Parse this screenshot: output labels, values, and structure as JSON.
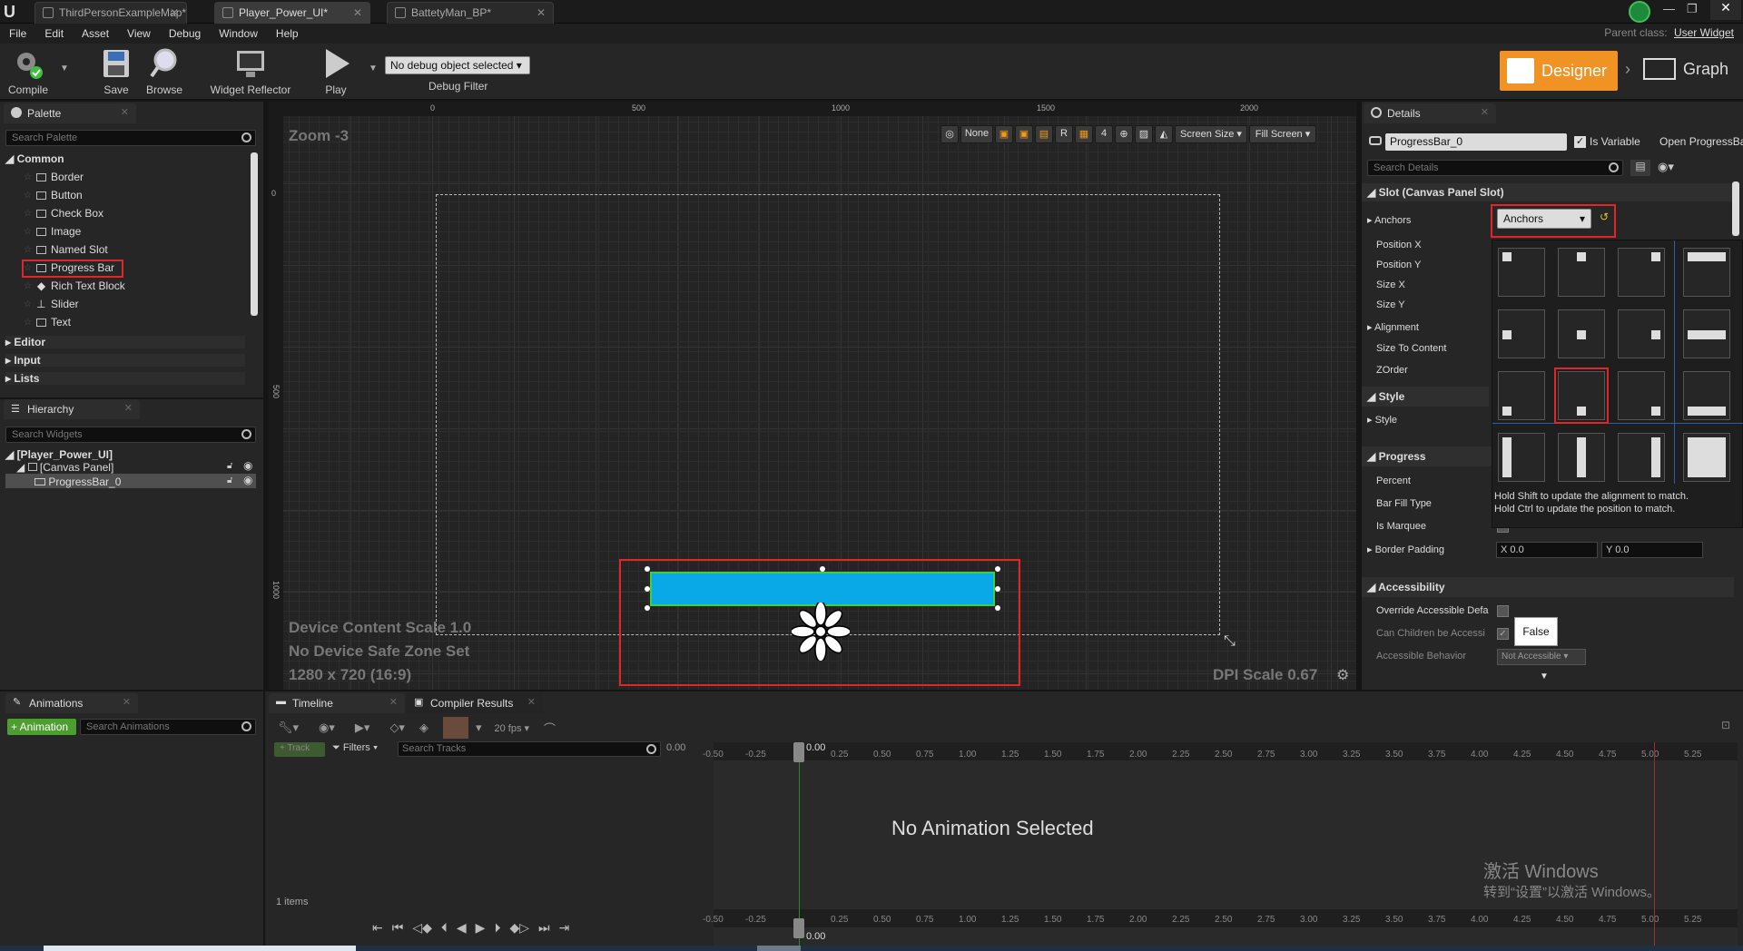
{
  "tabs": [
    {
      "label": "ThirdPersonExampleMap*",
      "active": false
    },
    {
      "label": "Player_Power_UI*",
      "active": true
    },
    {
      "label": "BattetyMan_BP*",
      "active": false
    }
  ],
  "parent_class": {
    "label": "Parent class:",
    "value": "User Widget"
  },
  "menu": [
    "File",
    "Edit",
    "Asset",
    "View",
    "Debug",
    "Window",
    "Help"
  ],
  "toolbar": {
    "compile": "Compile",
    "save": "Save",
    "browse": "Browse",
    "reflector": "Widget Reflector",
    "play": "Play",
    "debug_select": "No debug object selected",
    "debug_filter": "Debug Filter",
    "designer": "Designer",
    "graph": "Graph"
  },
  "palette": {
    "tab": "Palette",
    "search": "Search Palette",
    "category": "Common",
    "items": [
      "Border",
      "Button",
      "Check Box",
      "Image",
      "Named Slot",
      "Progress Bar",
      "Rich Text Block",
      "Slider",
      "Text"
    ],
    "collapsed": [
      "Editor",
      "Input",
      "Lists"
    ]
  },
  "hierarchy": {
    "tab": "Hierarchy",
    "search": "Search Widgets",
    "root": "[Player_Power_UI]",
    "panel": "[Canvas Panel]",
    "child": "ProgressBar_0"
  },
  "canvas": {
    "zoom": "Zoom -3",
    "rulers_x": [
      "0",
      "500",
      "1000",
      "1500",
      "2000"
    ],
    "rulers_y": [
      "0",
      "500",
      "1000"
    ],
    "none_btn": "None",
    "r_btn": "R",
    "grid_num": "4",
    "screen_size": "Screen Size",
    "fill_screen": "Fill Screen",
    "info1": "Device Content Scale 1.0",
    "info2": "No Device Safe Zone Set",
    "info3": "1280 x 720 (16:9)",
    "dpi": "DPI Scale 0.67"
  },
  "details": {
    "tab": "Details",
    "name": "ProgressBar_0",
    "is_variable": "Is Variable",
    "open_link": "Open ProgressBa",
    "search": "Search Details",
    "slot_section": "Slot (Canvas Panel Slot)",
    "anchors_label": "Anchors",
    "anchors_btn": "Anchors",
    "props": [
      "Position X",
      "Position Y",
      "Size X",
      "Size Y",
      "Alignment",
      "Size To Content",
      "ZOrder"
    ],
    "style_section": "Style",
    "style_prop": "Style",
    "progress_section": "Progress",
    "progress_props": [
      "Percent",
      "Bar Fill Type",
      "Is Marquee",
      "Border Padding"
    ],
    "border_x": "X 0.0",
    "border_y": "Y 0.0",
    "access_section": "Accessibility",
    "access_props": [
      "Override Accessible Defa",
      "Can Children be Accessi",
      "Accessible Behavior"
    ],
    "false_tip": "False",
    "not_accessible": "Not Accessible",
    "hint1": "Hold Shift to update the alignment to match.",
    "hint2": "Hold Ctrl to update the position to match."
  },
  "animations": {
    "tab": "Animations",
    "add_btn": "+ Animation",
    "search": "Search Animations",
    "count": "1 items"
  },
  "timeline": {
    "tab": "Timeline",
    "tab2": "Compiler Results",
    "fps": "20 fps",
    "track": "+ Track",
    "filters": "Filters",
    "search_tracks": "Search Tracks",
    "time": "0.00",
    "empty": "No Animation Selected",
    "ticks": [
      "-0.50",
      "-0.25",
      "0.25",
      "0.50",
      "0.75",
      "1.00",
      "1.25",
      "1.50",
      "1.75",
      "2.00",
      "2.25",
      "2.50",
      "2.75",
      "3.00",
      "3.25",
      "3.50",
      "3.75",
      "4.00",
      "4.25",
      "4.50",
      "4.75",
      "5.00",
      "5.25"
    ],
    "cursor_label": "0.00"
  },
  "watermark": {
    "line1": "激活 Windows",
    "line2": "转到“设置”以激活 Windows。"
  }
}
